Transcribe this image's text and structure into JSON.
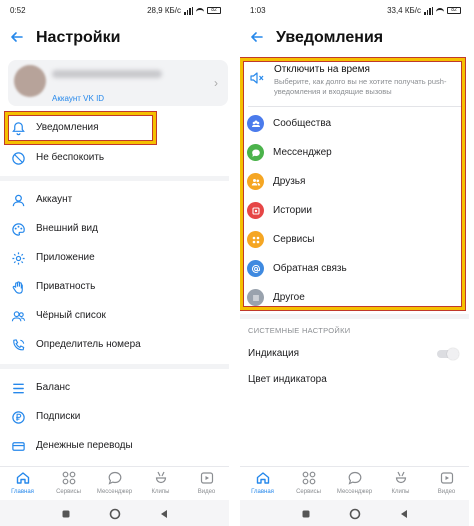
{
  "left": {
    "status": {
      "time": "0:52",
      "net": "28,9 КБ/с",
      "battery": "82"
    },
    "header": {
      "title": "Настройки"
    },
    "profile": {
      "subtitle": "Аккаунт VK ID"
    },
    "items": [
      {
        "label": "Уведомления",
        "icon": "bell-icon"
      },
      {
        "label": "Не беспокоить",
        "icon": "do-not-disturb-icon"
      },
      {
        "label": "Аккаунт",
        "icon": "user-icon"
      },
      {
        "label": "Внешний вид",
        "icon": "palette-icon"
      },
      {
        "label": "Приложение",
        "icon": "gear-icon"
      },
      {
        "label": "Приватность",
        "icon": "hand-icon"
      },
      {
        "label": "Чёрный список",
        "icon": "users-icon"
      },
      {
        "label": "Определитель номера",
        "icon": "phone-icon"
      },
      {
        "label": "Баланс",
        "icon": "balance-icon"
      },
      {
        "label": "Подписки",
        "icon": "ruble-icon"
      },
      {
        "label": "Денежные переводы",
        "icon": "money-transfer-icon"
      }
    ],
    "tabs": [
      {
        "label": "Главная",
        "icon": "home-icon",
        "active": true
      },
      {
        "label": "Сервисы",
        "icon": "services-icon"
      },
      {
        "label": "Мессенджер",
        "icon": "messenger-icon"
      },
      {
        "label": "Клипы",
        "icon": "clips-icon"
      },
      {
        "label": "Видео",
        "icon": "video-icon"
      }
    ]
  },
  "right": {
    "status": {
      "time": "1:03",
      "net": "33,4 КБ/с",
      "battery": "82"
    },
    "header": {
      "title": "Уведомления"
    },
    "mute": {
      "title": "Отключить на время",
      "description": "Выберите, как долго вы не хотите получать push-уведомления и входящие вызовы",
      "icon": "mute-icon"
    },
    "categories": [
      {
        "label": "Сообщества",
        "color": "#4b7bec",
        "icon": "communities-icon"
      },
      {
        "label": "Мессенджер",
        "color": "#4bb34b",
        "icon": "message-icon"
      },
      {
        "label": "Друзья",
        "color": "#f5a623",
        "icon": "friends-icon"
      },
      {
        "label": "Истории",
        "color": "#e64646",
        "icon": "stories-icon"
      },
      {
        "label": "Сервисы",
        "color": "#f5a623",
        "icon": "services-icon"
      },
      {
        "label": "Обратная связь",
        "color": "#3f8ae0",
        "icon": "at-icon"
      },
      {
        "label": "Другое",
        "color": "#99a2ad",
        "icon": "other-icon"
      }
    ],
    "system_header": "СИСТЕМНЫЕ НАСТРОЙКИ",
    "indication": {
      "label": "Индикация",
      "enabled": false
    },
    "indicator_color": {
      "label": "Цвет индикатора"
    },
    "tabs": [
      {
        "label": "Главная",
        "icon": "home-icon",
        "active": true
      },
      {
        "label": "Сервисы",
        "icon": "services-icon"
      },
      {
        "label": "Мессенджер",
        "icon": "messenger-icon"
      },
      {
        "label": "Клипы",
        "icon": "clips-icon"
      },
      {
        "label": "Видео",
        "icon": "video-icon"
      }
    ]
  },
  "colors": {
    "accent": "#2688eb",
    "highlight": "#f5c000",
    "highlight_border": "#c0392b"
  }
}
